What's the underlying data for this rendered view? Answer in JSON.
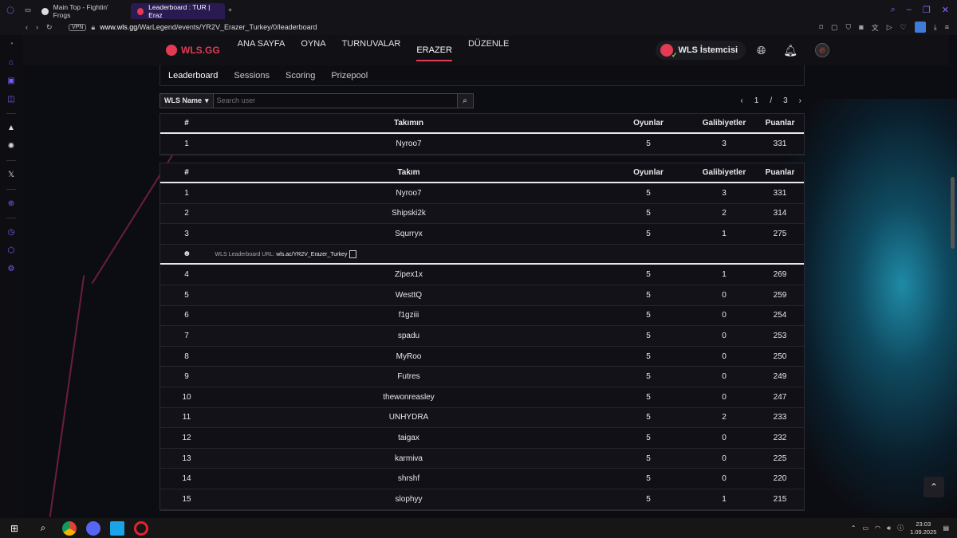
{
  "browser": {
    "tabs": [
      {
        "label": "Main Top - Fightin' Frogs"
      },
      {
        "label": "Leaderboard : TUR | Eraz"
      }
    ],
    "new_tab": "+",
    "vpn": "VPN",
    "url_host": "www.wls.gg",
    "url_path": "/WarLegend/events/YR2V_Erazer_Turkey/0/leaderboard"
  },
  "nav": {
    "logo": "WLS.GG",
    "items": [
      "ANA SAYFA",
      "OYNA",
      "TURNUVALAR",
      "ERAZER",
      "DÜZENLE"
    ],
    "client": "WLS İstemcisi"
  },
  "subnav": [
    "Leaderboard",
    "Sessions",
    "Scoring",
    "Prizepool"
  ],
  "toolbar": {
    "select": "WLS Name",
    "search_placeholder": "Search user",
    "page": "1",
    "slash": "/",
    "total": "3",
    "prev": "‹",
    "next": "›"
  },
  "my_table": {
    "headers": [
      "#",
      "Takımın",
      "Oyunlar",
      "Galibiyetler",
      "Puanlar"
    ],
    "rows": [
      [
        "1",
        "Nyroo7",
        "5",
        "3",
        "331"
      ]
    ]
  },
  "main_table": {
    "headers": [
      "#",
      "Takım",
      "Oyunlar",
      "Galibiyetler",
      "Puanlar"
    ],
    "rows_top": [
      [
        "1",
        "Nyroo7",
        "5",
        "3",
        "331"
      ],
      [
        "2",
        "Shipski2k",
        "5",
        "2",
        "314"
      ],
      [
        "3",
        "Squrryx",
        "5",
        "1",
        "275"
      ]
    ],
    "url_label": "WLS Leaderboard URL:",
    "url_value": "wls.ac/YR2V_Erazer_Turkey",
    "rows_rest": [
      [
        "4",
        "Zipex1x",
        "5",
        "1",
        "269"
      ],
      [
        "5",
        "WesttQ",
        "5",
        "0",
        "259"
      ],
      [
        "6",
        "f1gziii",
        "5",
        "0",
        "254"
      ],
      [
        "7",
        "spadu",
        "5",
        "0",
        "253"
      ],
      [
        "8",
        "MyRoo",
        "5",
        "0",
        "250"
      ],
      [
        "9",
        "Futres",
        "5",
        "0",
        "249"
      ],
      [
        "10",
        "thewonreasley",
        "5",
        "0",
        "247"
      ],
      [
        "11",
        "UNHYDRA",
        "5",
        "2",
        "233"
      ],
      [
        "12",
        "taigax",
        "5",
        "0",
        "232"
      ],
      [
        "13",
        "karmiva",
        "5",
        "0",
        "225"
      ],
      [
        "14",
        "shrshf",
        "5",
        "0",
        "220"
      ],
      [
        "15",
        "slophyy",
        "5",
        "1",
        "215"
      ]
    ]
  },
  "taskbar": {
    "time": "23:03",
    "date": "1.09.2025"
  }
}
